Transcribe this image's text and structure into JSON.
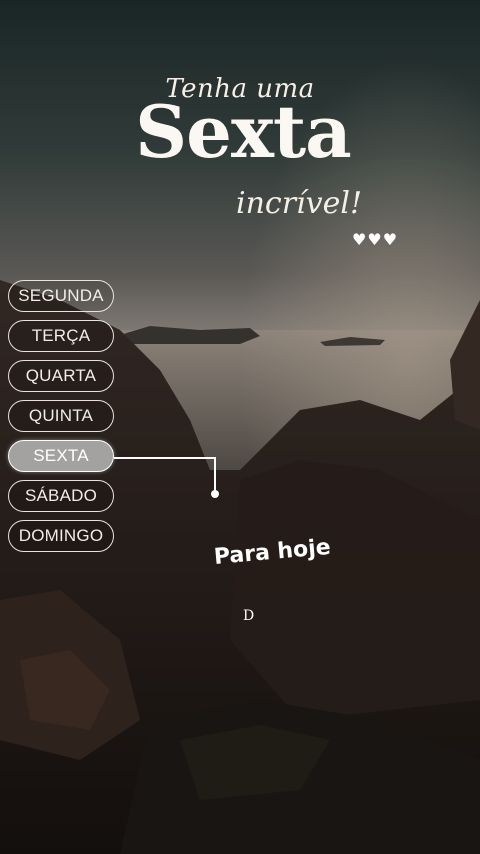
{
  "title": {
    "line1": "Tenha uma",
    "main": "Sexta",
    "line3": "incrível!",
    "hearts": "♥♥♥"
  },
  "days": [
    {
      "label": "SEGUNDA",
      "active": false
    },
    {
      "label": "TERÇA",
      "active": false
    },
    {
      "label": "QUARTA",
      "active": false
    },
    {
      "label": "QUINTA",
      "active": false
    },
    {
      "label": "SEXTA",
      "active": true
    },
    {
      "label": "SÁBADO",
      "active": false
    },
    {
      "label": "DOMINGO",
      "active": false
    }
  ],
  "today": {
    "heading": "Para hoje",
    "letter": "D"
  }
}
